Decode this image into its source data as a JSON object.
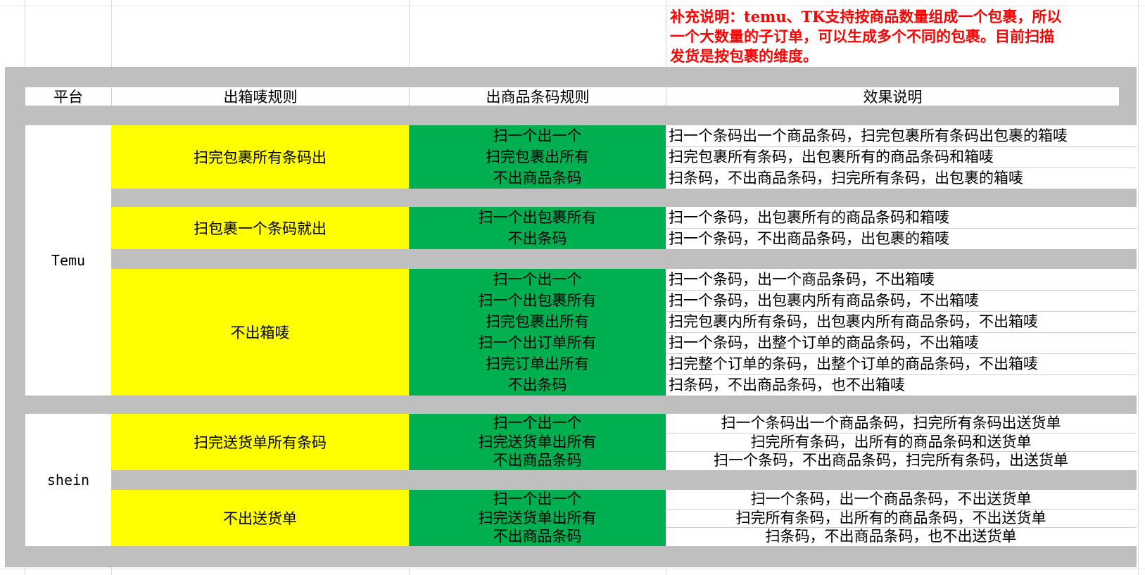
{
  "note": {
    "lines": [
      "补充说明：temu、TK支持按商品数量组成一个包裹，所以",
      "一个大数量的子订单，可以生成多个不同的包裹。目前扫描",
      "发货是按包裹的维度。"
    ]
  },
  "headers": {
    "platform": "平台",
    "box_rule": "出箱唛规则",
    "barcode_rule": "出商品条码规则",
    "effect": "效果说明"
  },
  "temu": {
    "platform": "Temu",
    "groups": [
      {
        "box_rule": "扫完包裹所有条码出",
        "barcode_rules": [
          "扫一个出一个",
          "扫完包裹出所有",
          "不出商品条码"
        ],
        "effects": [
          "扫一个条码出一个商品条码，扫完包裹所有条码出包裹的箱唛",
          "扫完包裹所有条码，出包裹所有的商品条码和箱唛",
          "扫条码，不出商品条码，扫完所有条码，出包裹的箱唛"
        ]
      },
      {
        "box_rule": "扫包裹一个条码就出",
        "barcode_rules": [
          "扫一个出包裹所有",
          "不出条码"
        ],
        "effects": [
          "扫一个条码，出包裹所有的商品条码和箱唛",
          "扫一个条码，不出商品条码，出包裹的箱唛"
        ]
      },
      {
        "box_rule": "不出箱唛",
        "barcode_rules": [
          "扫一个出一个",
          "扫一个出包裹所有",
          "扫完包裹出所有",
          "扫一个出订单所有",
          "扫完订单出所有",
          "不出条码"
        ],
        "effects": [
          "扫一个条码，出一个商品条码，不出箱唛",
          "扫一个条码，出包裹内所有商品条码，不出箱唛",
          "扫完包裹内所有条码，出包裹内所有商品条码，不出箱唛",
          "扫一个条码，出整个订单的商品条码，不出箱唛",
          "扫完整个订单的条码，出整个订单的商品条码，不出箱唛",
          "扫条码，不出商品条码，也不出箱唛"
        ]
      }
    ]
  },
  "shein": {
    "platform": "shein",
    "groups": [
      {
        "box_rule": "扫完送货单所有条码",
        "barcode_rules": [
          "扫一个出一个",
          "扫完送货单出所有",
          "不出商品条码"
        ],
        "effects": [
          "扫一个条码出一个商品条码，扫完所有条码出送货单",
          "扫完所有条码，出所有的商品条码和送货单",
          "扫一个条码，不出商品条码，扫完所有条码，出送货单"
        ]
      },
      {
        "box_rule": "不出送货单",
        "barcode_rules": [
          "扫一个出一个",
          "扫完送货单出所有",
          "不出商品条码"
        ],
        "effects": [
          "扫一个条码，出一个商品条码，不出送货单",
          "扫完所有条码，出所有的商品条码，不出送货单",
          "扫条码，不出商品条码，也不出送货单"
        ]
      }
    ]
  },
  "colors": {
    "frame": "#bfbfbf",
    "box_rule_fill": "#ffff00",
    "barcode_fill": "#00b050",
    "note_text": "#ff0000"
  }
}
